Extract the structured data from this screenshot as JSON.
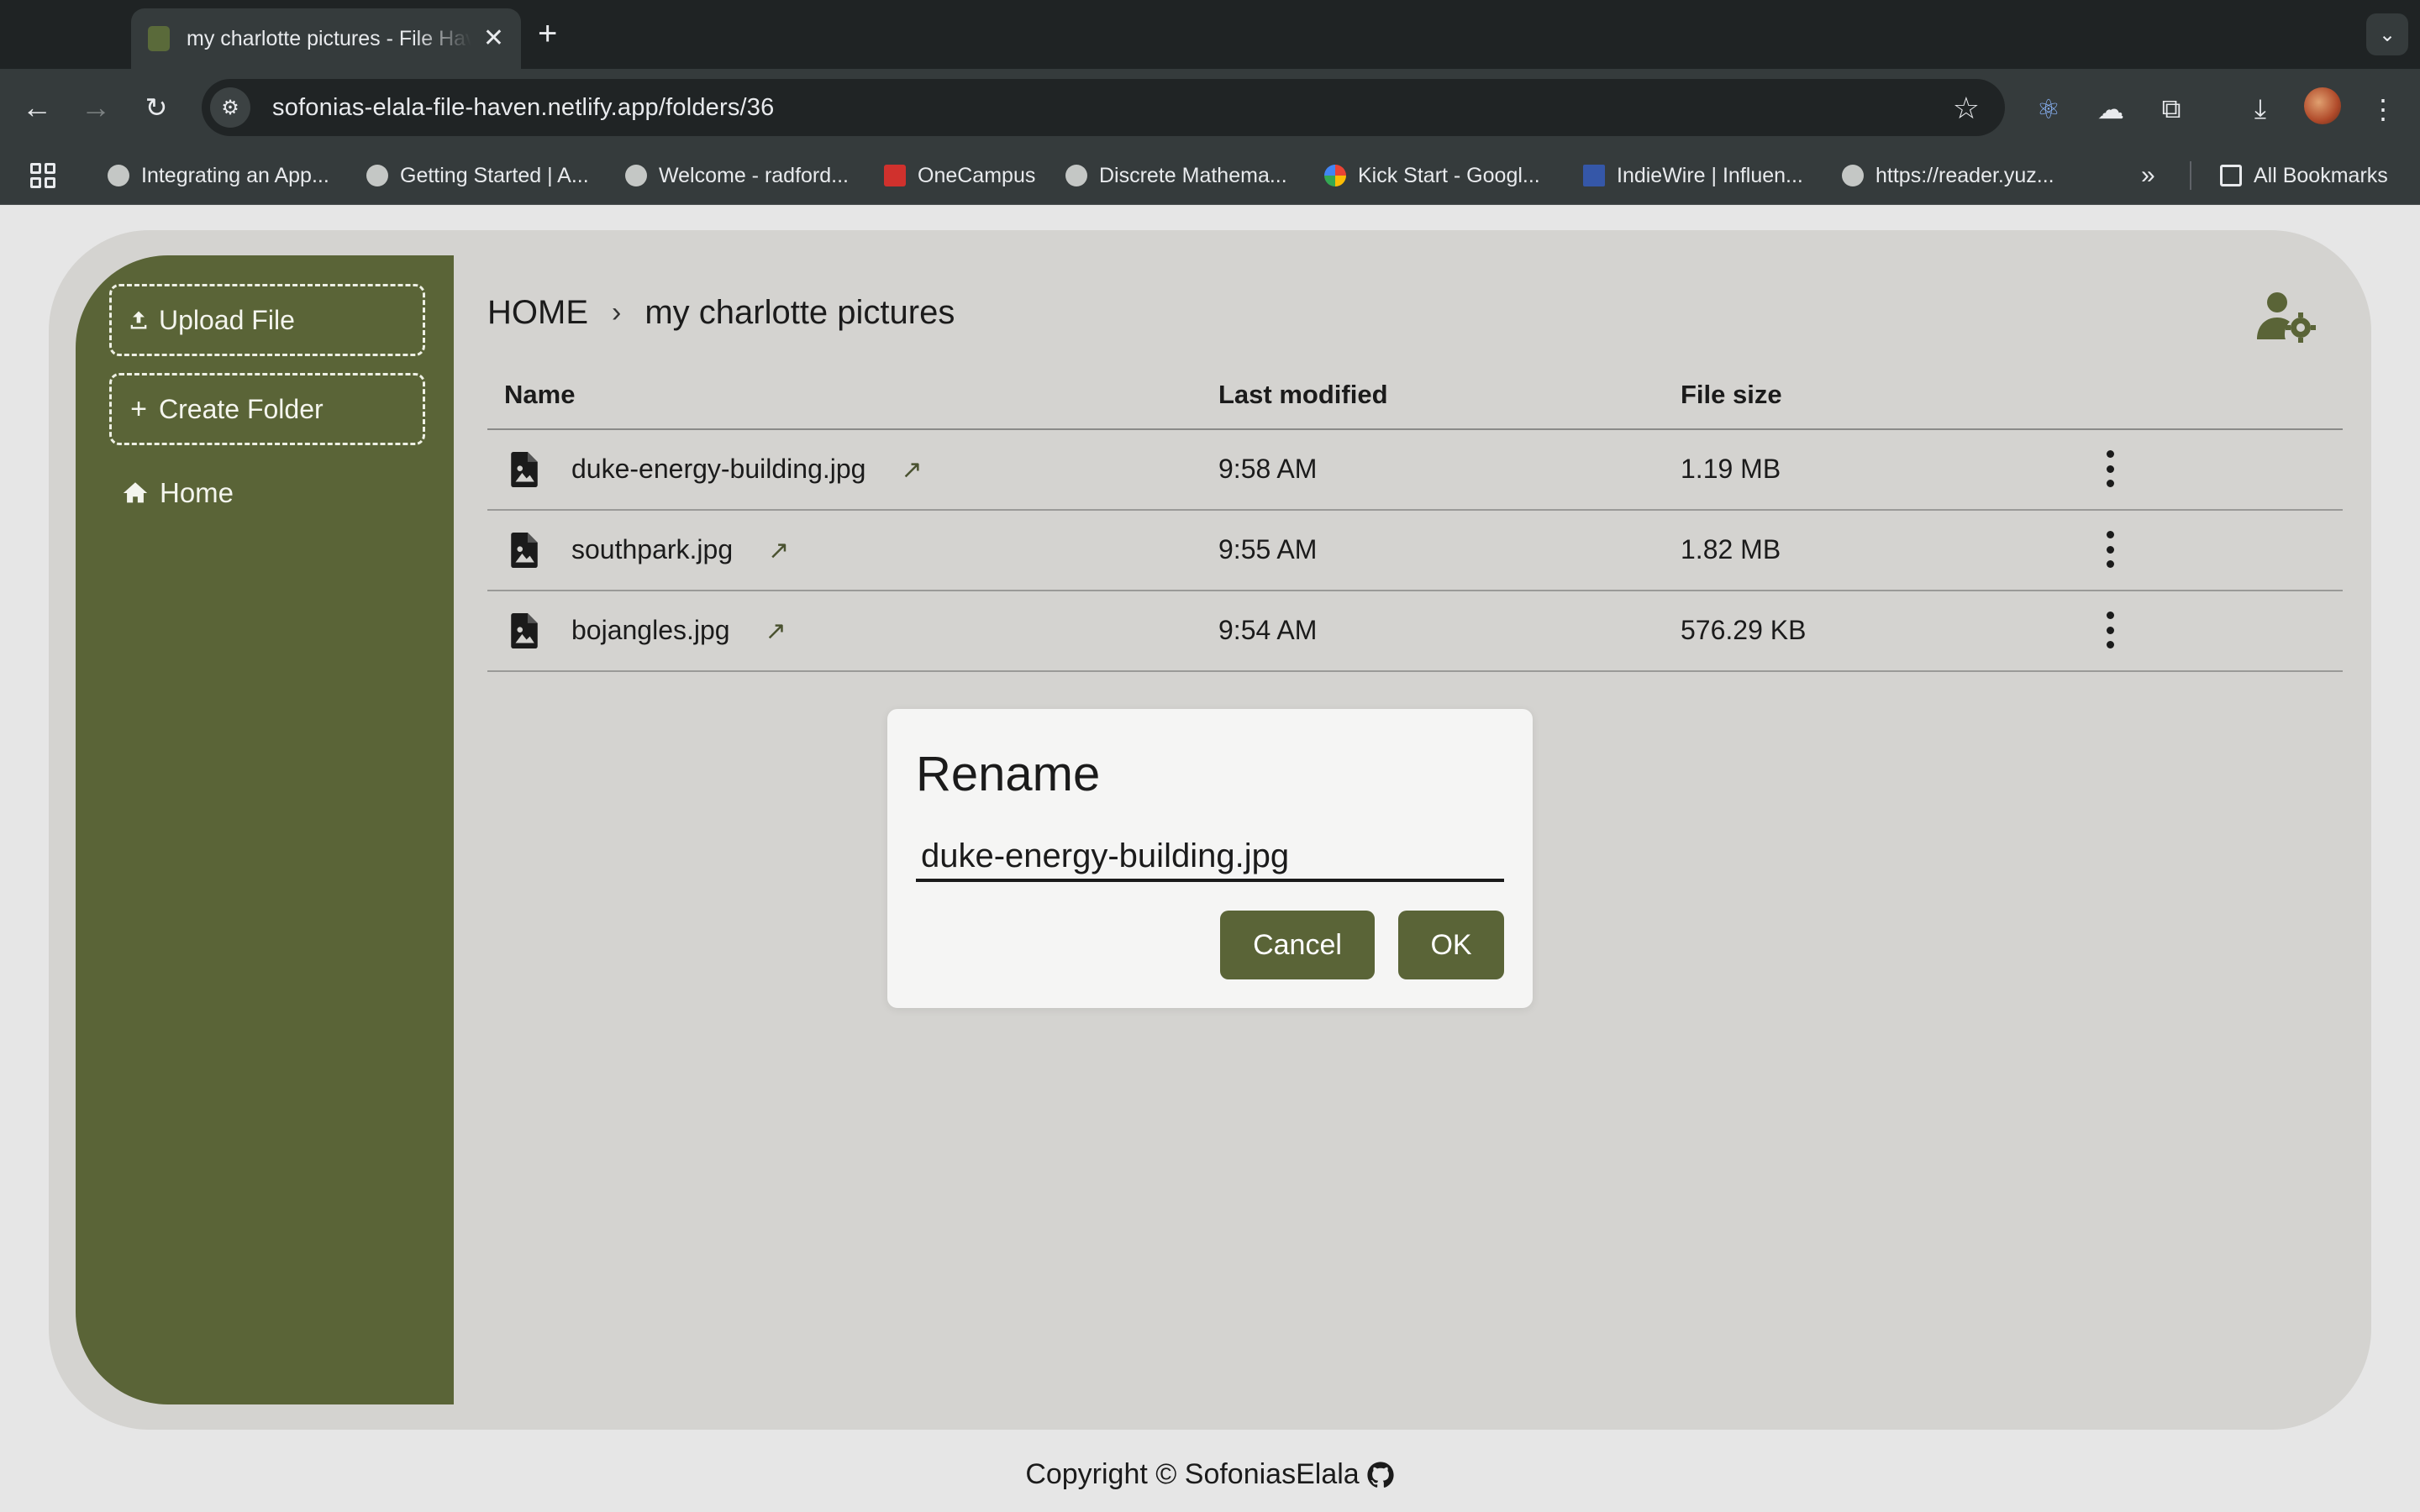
{
  "browser": {
    "tab_title": "my charlotte pictures - File Haven",
    "url": "sofonias-elala-file-haven.netlify.app/folders/36",
    "bookmarks": [
      {
        "label": "Integrating an App..."
      },
      {
        "label": "Getting Started | A..."
      },
      {
        "label": "Welcome - radford..."
      },
      {
        "label": "OneCampus"
      },
      {
        "label": "Discrete Mathema..."
      },
      {
        "label": "Kick Start - Googl..."
      },
      {
        "label": "IndieWire | Influen..."
      },
      {
        "label": "https://reader.yuz..."
      }
    ],
    "all_bookmarks_label": "All Bookmarks"
  },
  "sidebar": {
    "upload_label": "Upload File",
    "create_folder_label": "Create Folder",
    "home_label": "Home"
  },
  "breadcrumb": {
    "root": "HOME",
    "current": "my charlotte pictures"
  },
  "table": {
    "headers": {
      "name": "Name",
      "modified": "Last modified",
      "size": "File size"
    },
    "rows": [
      {
        "name": "duke-energy-building.jpg",
        "modified": "9:58 AM",
        "size": "1.19 MB"
      },
      {
        "name": "southpark.jpg",
        "modified": "9:55 AM",
        "size": "1.82 MB"
      },
      {
        "name": "bojangles.jpg",
        "modified": "9:54 AM",
        "size": "576.29 KB"
      }
    ]
  },
  "dialog": {
    "title": "Rename",
    "value": "duke-energy-building.jpg",
    "cancel_label": "Cancel",
    "ok_label": "OK"
  },
  "footer": {
    "text": "Copyright © SofoniasElala"
  },
  "colors": {
    "accent": "#5a6437",
    "page_bg": "#d4d3d0"
  }
}
